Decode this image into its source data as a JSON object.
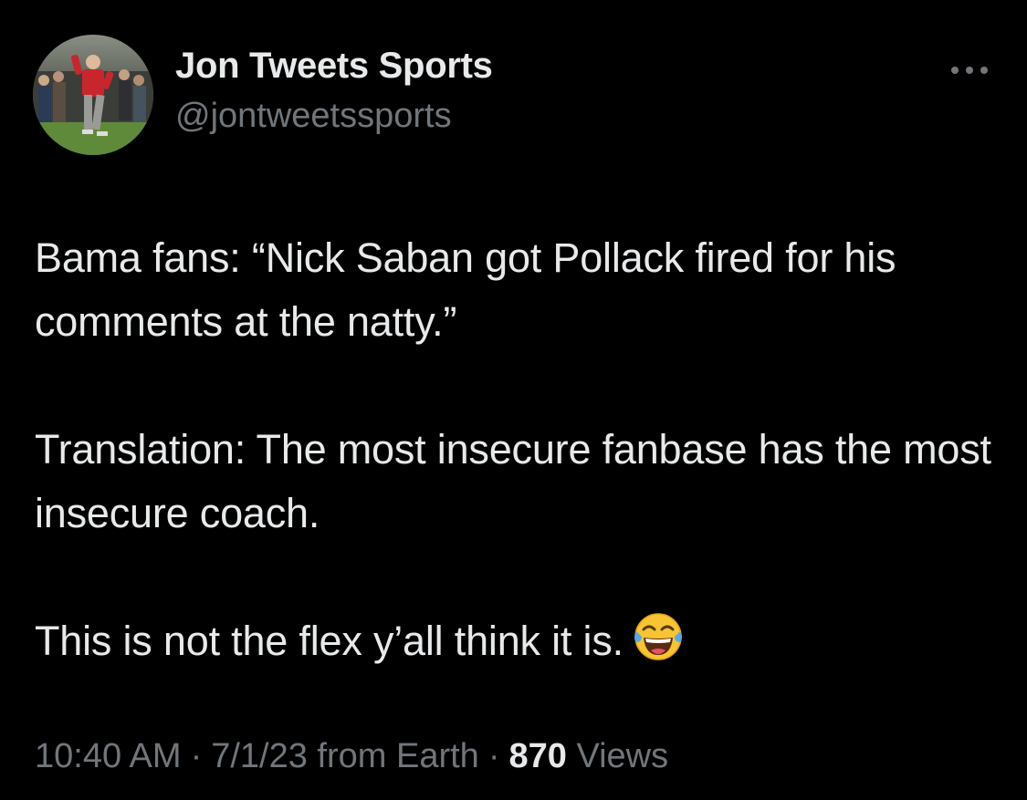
{
  "author": {
    "display_name": "Jon Tweets Sports",
    "handle": "@jontweetssports",
    "avatar_icon": "golfer-celebrating-photo"
  },
  "menu": {
    "icon": "more-horizontal-icon"
  },
  "tweet": {
    "paragraphs": [
      "Bama fans: “Nick Saban got Pollack fired for his comments at the natty.”",
      "Translation: The most insecure fanbase has the most insecure coach.",
      "This is not the flex y’all think it is."
    ],
    "emoji": "face-with-tears-of-joy-emoji"
  },
  "meta": {
    "time": "10:40 AM",
    "separator": "·",
    "date_source": "7/1/23 from Earth",
    "views_count": "870",
    "views_label": "Views"
  },
  "colors": {
    "background": "#000000",
    "primary_text": "#e7e9ea",
    "secondary_text": "#71767b"
  }
}
